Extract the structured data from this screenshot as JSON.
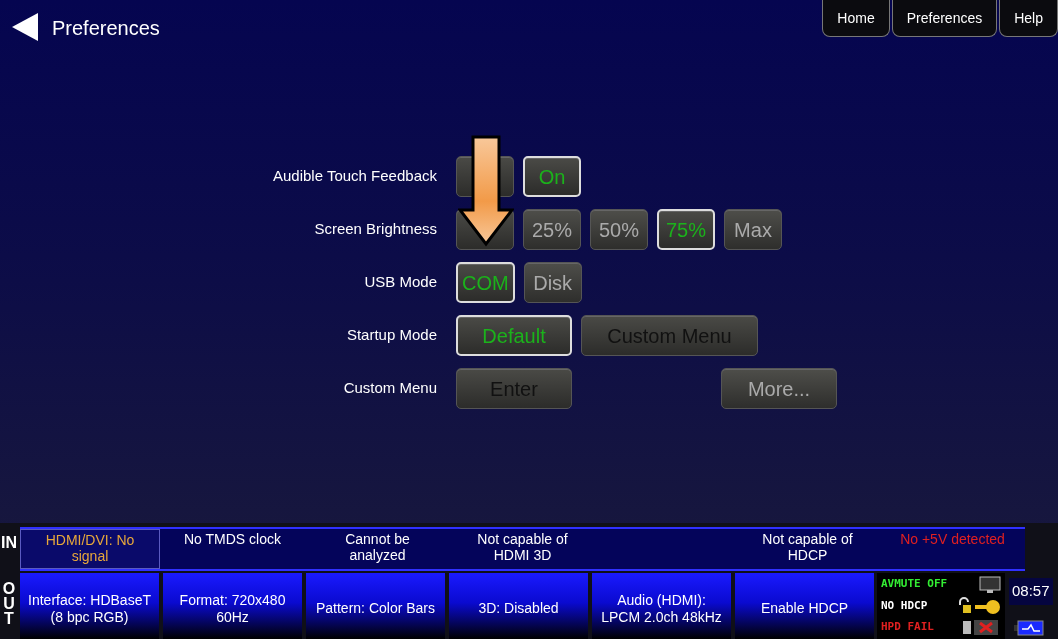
{
  "header": {
    "title": "Preferences"
  },
  "nav_tabs": [
    {
      "label": "Home"
    },
    {
      "label": "Preferences"
    },
    {
      "label": "Help"
    }
  ],
  "settings": [
    {
      "label": "Audible Touch Feedback",
      "kind": "choice",
      "options": [
        {
          "selected": false
        },
        {
          "label": "On",
          "selected": true,
          "disabled": false
        }
      ]
    },
    {
      "label": "Screen Brightness",
      "kind": "choice",
      "options": [
        {
          "selected": false
        },
        {
          "label": "25%",
          "selected": false,
          "disabled": true
        },
        {
          "label": "50%",
          "selected": false,
          "disabled": true
        },
        {
          "label": "75%",
          "selected": true,
          "disabled": false
        },
        {
          "label": "Max",
          "selected": false,
          "disabled": true
        }
      ]
    },
    {
      "label": "USB Mode",
      "kind": "choice",
      "options": [
        {
          "label": "COM",
          "selected": true,
          "disabled": false
        },
        {
          "label": "Disk",
          "selected": false,
          "disabled": true
        }
      ]
    },
    {
      "label": "Startup Mode",
      "kind": "wide",
      "options": [
        {
          "label": "Default",
          "selected": true,
          "disabled": false
        },
        {
          "label": "Custom Menu",
          "selected": false,
          "disabled": false
        }
      ]
    },
    {
      "label": "Custom Menu",
      "kind": "actions",
      "options": [
        {
          "label": "Enter",
          "selected": false,
          "disabled": false
        },
        {
          "label": "More...",
          "selected": false,
          "disabled": true
        }
      ]
    }
  ],
  "status_in": {
    "label": "IN",
    "cells": [
      {
        "text": "HDMI/DVI: No signal",
        "color": "#e8a83a",
        "selected": true
      },
      {
        "text": "No TMDS clock",
        "color": "#ffffff",
        "selected": false
      },
      {
        "text": "Cannot be analyzed",
        "color": "#ffffff",
        "selected": false
      },
      {
        "text": "Not capable of HDMI 3D",
        "color": "#ffffff",
        "selected": false
      },
      {
        "text": "Not capable of HDCP",
        "color": "#ffffff",
        "selected": false
      },
      {
        "text": "No +5V detected",
        "color": "#e02020",
        "selected": false
      }
    ]
  },
  "status_out": {
    "label": "OUT",
    "cells": [
      {
        "text": "Interface: HDBaseT (8 bpc RGB)"
      },
      {
        "text": "Format: 720x480 60Hz"
      },
      {
        "text": "Pattern: Color Bars"
      },
      {
        "text": "3D: Disabled"
      },
      {
        "text": "Audio (HDMI): LPCM 2.0ch 48kHz"
      },
      {
        "text": "Enable HDCP"
      }
    ]
  },
  "indicators": [
    {
      "text": "AVMUTE OFF",
      "color": "#33ee33",
      "kind": "monitor"
    },
    {
      "text": "NO HDCP",
      "color": "#ffffff",
      "kind": "key"
    },
    {
      "text": "HPD FAIL",
      "color": "#e02020",
      "kind": "cable"
    }
  ],
  "clock": "08:57"
}
